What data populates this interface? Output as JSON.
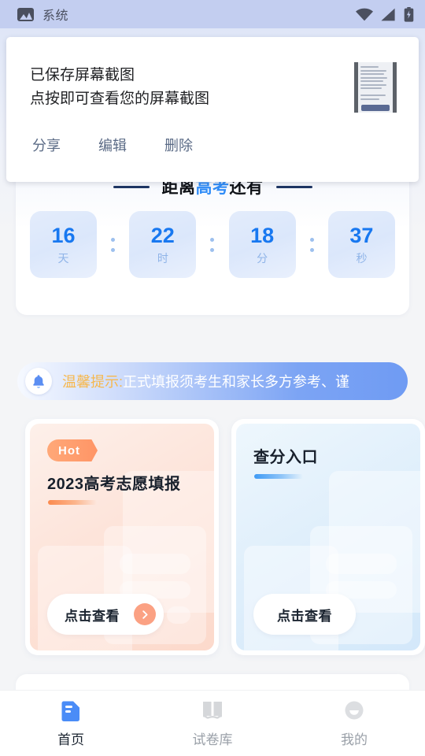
{
  "statusbar": {
    "app_label": "系统",
    "photo_icon": "image-icon",
    "wifi_icon": "wifi-icon",
    "signal_icon": "cellular-signal-icon",
    "battery_icon": "battery-charging-icon"
  },
  "notification": {
    "title": "已保存屏幕截图",
    "subtitle": "点按即可查看您的屏幕截图",
    "actions": [
      {
        "label": "分享",
        "name": "share-action"
      },
      {
        "label": "编辑",
        "name": "edit-action"
      },
      {
        "label": "删除",
        "name": "delete-action"
      }
    ],
    "thumbnail_name": "screenshot-thumbnail"
  },
  "countdown": {
    "title_prefix": "距离",
    "title_highlight": "高考",
    "title_suffix": "还有",
    "highlight_color": "#2f8cf7",
    "units": [
      {
        "value": "16",
        "label": "天"
      },
      {
        "value": "22",
        "label": "时"
      },
      {
        "value": "18",
        "label": "分"
      },
      {
        "value": "37",
        "label": "秒"
      }
    ]
  },
  "notice": {
    "bell_icon": "bell-icon",
    "keyword": "温馨提示:",
    "keyword_color": "#f6b84f",
    "message": "正式填报须考生和家长多方参考、谨"
  },
  "entry_cards": [
    {
      "badge": "Hot",
      "title": "2023高考志愿填报",
      "cta": "点击查看",
      "accent": "#fb8a4e",
      "has_arrow": true
    },
    {
      "badge": "",
      "title": "查分入口",
      "cta": "点击查看",
      "accent": "#3f9bf5",
      "has_arrow": false
    }
  ],
  "bottom_nav": [
    {
      "label": "首页",
      "icon": "document-icon",
      "active": true
    },
    {
      "label": "试卷库",
      "icon": "book-icon",
      "active": false
    },
    {
      "label": "我的",
      "icon": "profile-icon",
      "active": false
    }
  ]
}
